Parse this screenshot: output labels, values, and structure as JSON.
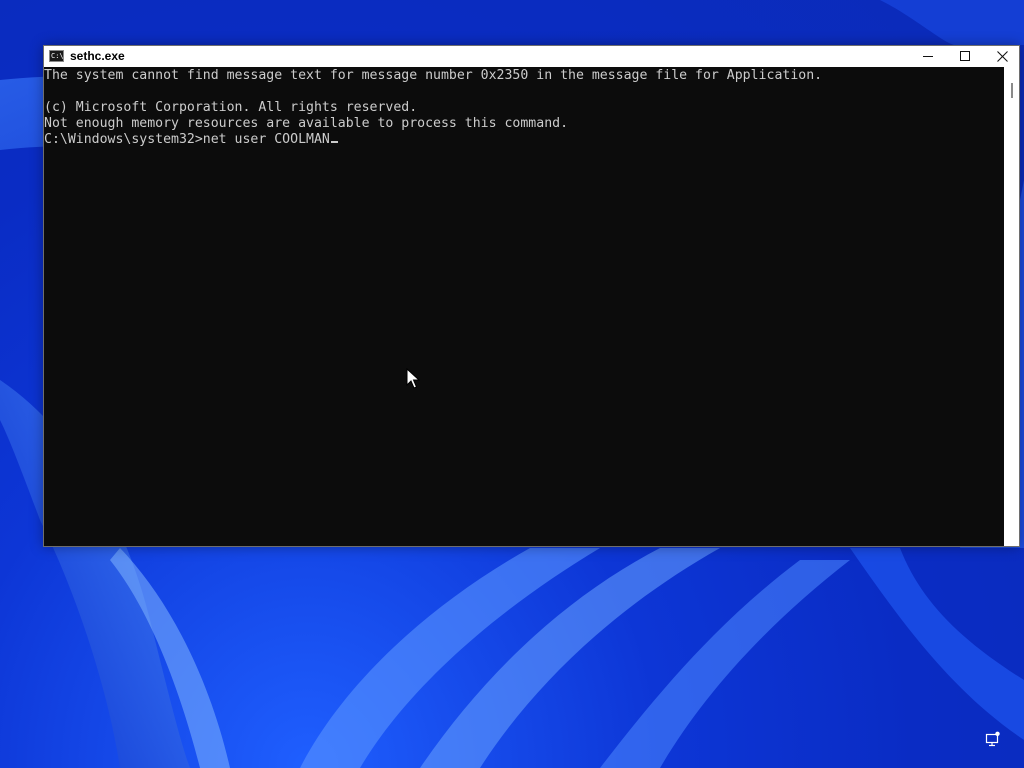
{
  "window": {
    "title": "sethc.exe",
    "icon_label": "C:\\"
  },
  "console": {
    "lines": [
      "The system cannot find message text for message number 0x2350 in the message file for Application.",
      "",
      "(c) Microsoft Corporation. All rights reserved.",
      "Not enough memory resources are available to process this command.",
      "C:\\Windows\\system32>net user COOLMAN"
    ]
  },
  "icons": {
    "app": "console-icon",
    "minimize": "minimize-icon",
    "maximize": "maximize-icon",
    "close": "close-icon",
    "pointer": "mouse-pointer-icon",
    "tray": "network-icon"
  },
  "colors": {
    "console_background": "#0c0c0c",
    "console_text": "#cccccc",
    "title_bar": "#ffffff",
    "desktop": "#0b2bb8"
  }
}
